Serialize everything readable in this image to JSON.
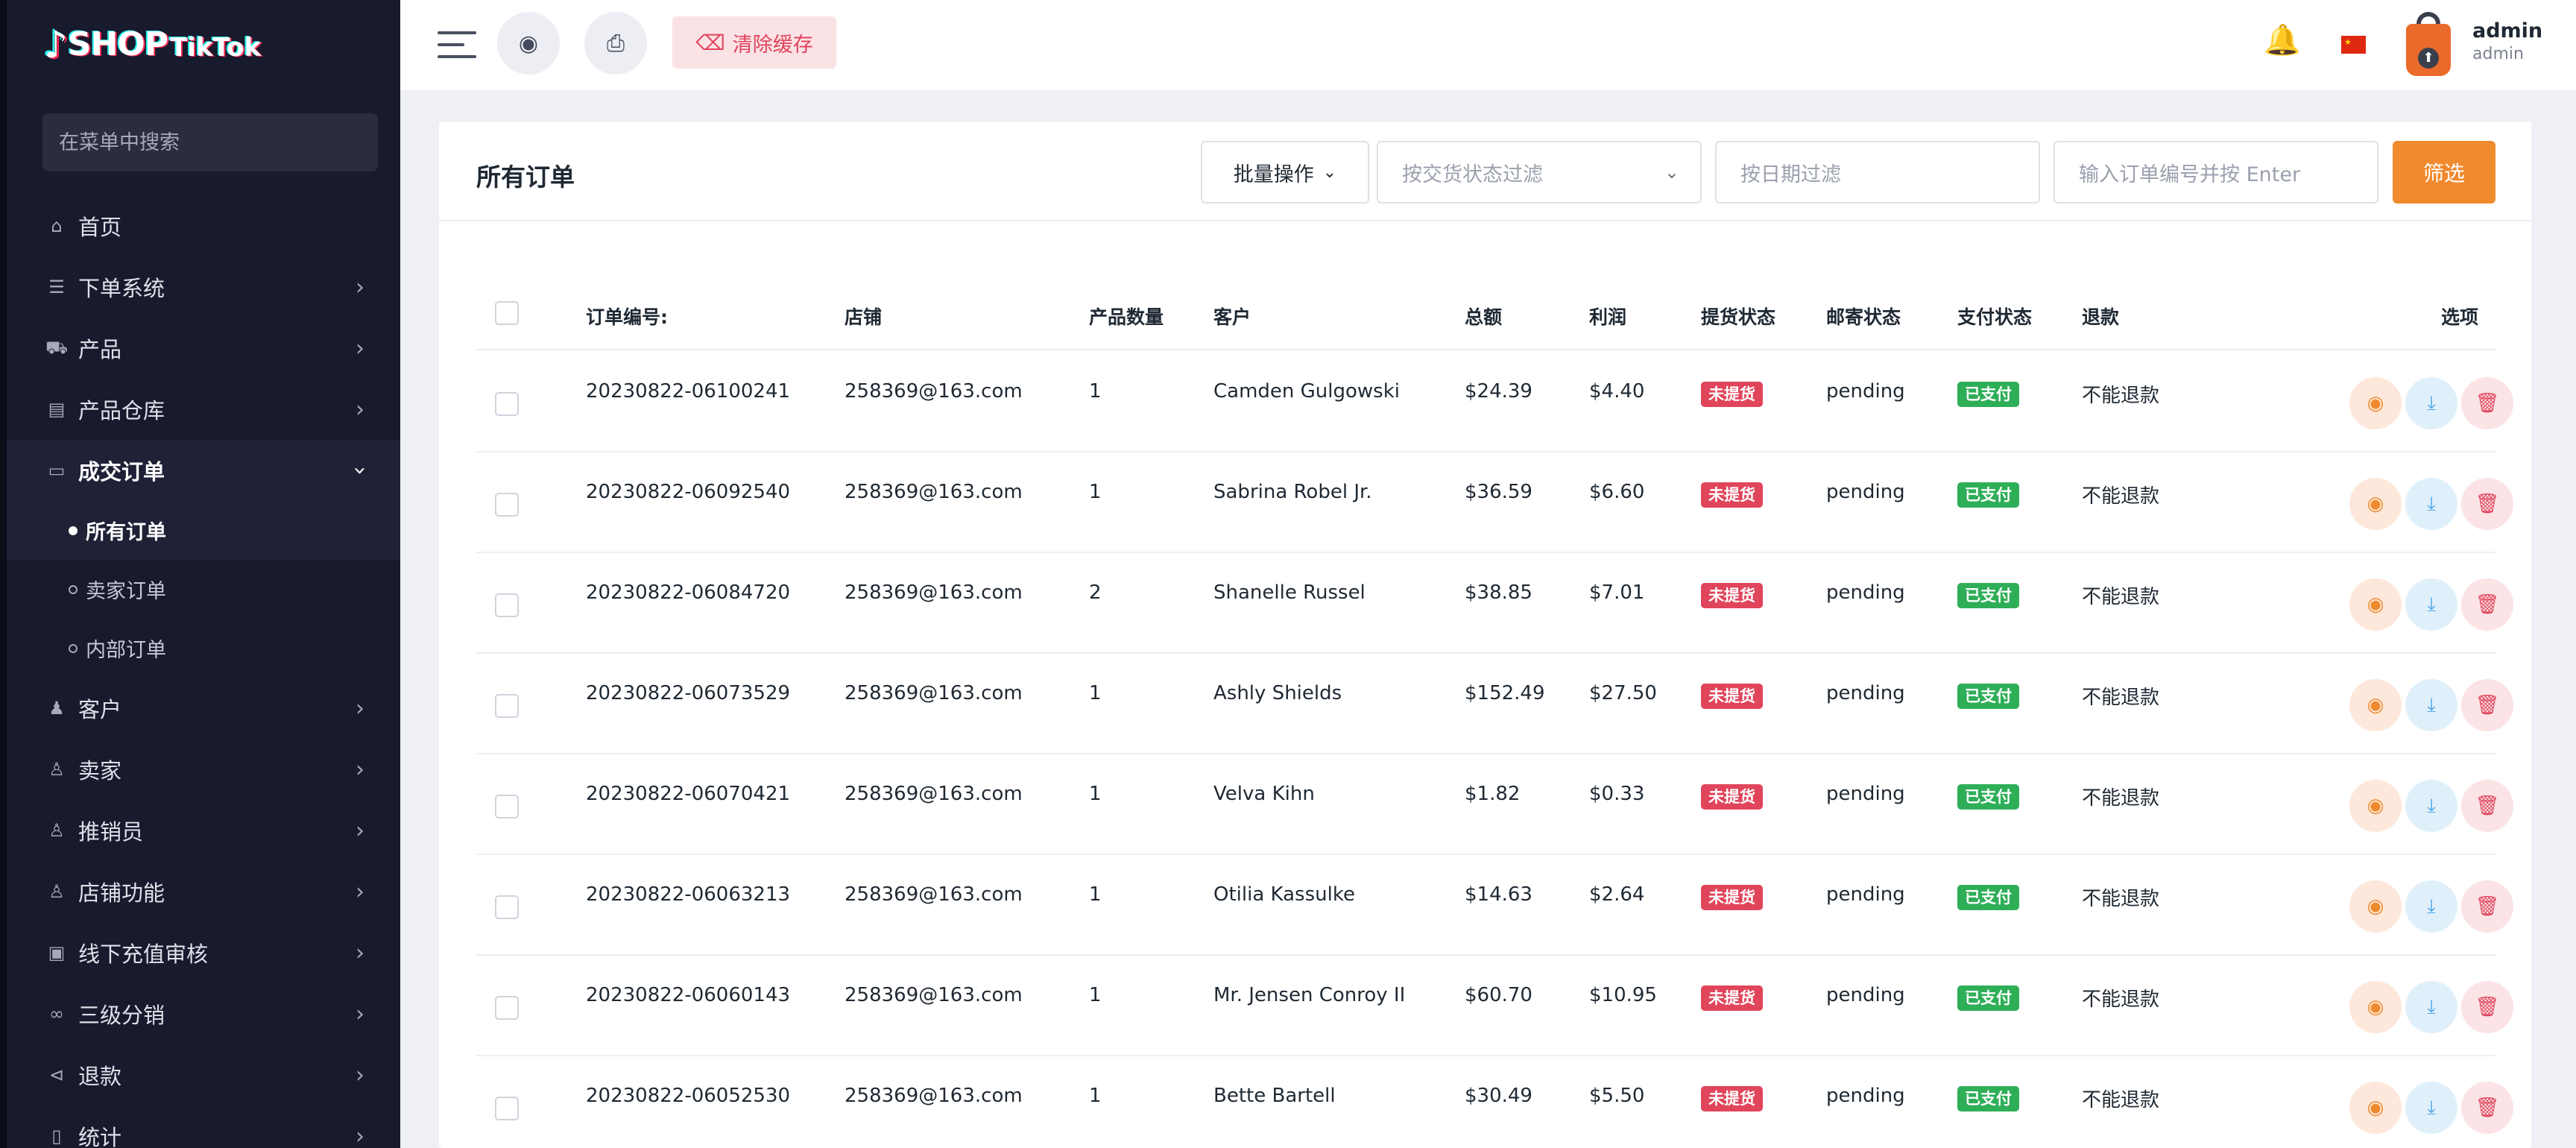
{
  "brand": {
    "note": "♪",
    "shop": "SHOP",
    "tiktok": "TikTok"
  },
  "sidebar": {
    "search_placeholder": "在菜单中搜索",
    "items": [
      {
        "label": "首页",
        "icon": "home-icon",
        "glyph": "⌂",
        "chevron": ""
      },
      {
        "label": "下单系统",
        "icon": "list-icon",
        "glyph": "☰",
        "chevron": "›"
      },
      {
        "label": "产品",
        "icon": "cart-icon",
        "glyph": "⛟",
        "chevron": "›"
      },
      {
        "label": "产品仓库",
        "icon": "warehouse-icon",
        "glyph": "▤",
        "chevron": "›"
      },
      {
        "label": "成交订单",
        "icon": "order-icon",
        "glyph": "▭",
        "chevron": "›"
      }
    ],
    "sub_items": [
      {
        "label": "所有订单"
      },
      {
        "label": "卖家订单"
      },
      {
        "label": "内部订单"
      }
    ],
    "items2": [
      {
        "label": "客户",
        "icon": "customers-icon",
        "glyph": "♟",
        "chevron": "›"
      },
      {
        "label": "卖家",
        "icon": "seller-icon",
        "glyph": "♙",
        "chevron": "›"
      },
      {
        "label": "推销员",
        "icon": "salesperson-icon",
        "glyph": "♙",
        "chevron": "›"
      },
      {
        "label": "店铺功能",
        "icon": "store-icon",
        "glyph": "♙",
        "chevron": "›"
      },
      {
        "label": "线下充值审核",
        "icon": "money-icon",
        "glyph": "▣",
        "chevron": "›"
      },
      {
        "label": "三级分销",
        "icon": "link-icon",
        "glyph": "∞",
        "chevron": "›"
      },
      {
        "label": "退款",
        "icon": "refund-icon",
        "glyph": "⊲",
        "chevron": "›"
      },
      {
        "label": "统计",
        "icon": "stats-icon",
        "glyph": "▯",
        "chevron": "›"
      }
    ]
  },
  "topbar": {
    "clear_cache": "清除缓存",
    "globe_glyph": "◉",
    "print_glyph": "⎙",
    "bell_glyph": "🔔",
    "user_name": "admin",
    "user_role": "admin"
  },
  "page": {
    "title": "所有订单",
    "batch_label": "批量操作",
    "delivery_filter_placeholder": "按交货状态过滤",
    "date_filter_placeholder": "按日期过滤",
    "order_search_placeholder": "输入订单编号并按 Enter",
    "filter_button": "筛选"
  },
  "table": {
    "headers": {
      "order_no": "订单编号:",
      "store": "店铺",
      "qty": "产品数量",
      "customer": "客户",
      "total": "总额",
      "profit": "利润",
      "pickup": "提货状态",
      "shipping": "邮寄状态",
      "payment": "支付状态",
      "refund": "退款",
      "options": "选项"
    },
    "rows": [
      {
        "order_no": "20230822-06100241",
        "store": "258369@163.com",
        "qty": "1",
        "customer": "Camden Gulgowski",
        "total": "$24.39",
        "profit": "$4.40",
        "pickup": "未提货",
        "shipping": "pending",
        "payment": "已支付",
        "refund": "不能退款"
      },
      {
        "order_no": "20230822-06092540",
        "store": "258369@163.com",
        "qty": "1",
        "customer": "Sabrina Robel Jr.",
        "total": "$36.59",
        "profit": "$6.60",
        "pickup": "未提货",
        "shipping": "pending",
        "payment": "已支付",
        "refund": "不能退款"
      },
      {
        "order_no": "20230822-06084720",
        "store": "258369@163.com",
        "qty": "2",
        "customer": "Shanelle Russel",
        "total": "$38.85",
        "profit": "$7.01",
        "pickup": "未提货",
        "shipping": "pending",
        "payment": "已支付",
        "refund": "不能退款"
      },
      {
        "order_no": "20230822-06073529",
        "store": "258369@163.com",
        "qty": "1",
        "customer": "Ashly Shields",
        "total": "$152.49",
        "profit": "$27.50",
        "pickup": "未提货",
        "shipping": "pending",
        "payment": "已支付",
        "refund": "不能退款"
      },
      {
        "order_no": "20230822-06070421",
        "store": "258369@163.com",
        "qty": "1",
        "customer": "Velva Kihn",
        "total": "$1.82",
        "profit": "$0.33",
        "pickup": "未提货",
        "shipping": "pending",
        "payment": "已支付",
        "refund": "不能退款"
      },
      {
        "order_no": "20230822-06063213",
        "store": "258369@163.com",
        "qty": "1",
        "customer": "Otilia Kassulke",
        "total": "$14.63",
        "profit": "$2.64",
        "pickup": "未提货",
        "shipping": "pending",
        "payment": "已支付",
        "refund": "不能退款"
      },
      {
        "order_no": "20230822-06060143",
        "store": "258369@163.com",
        "qty": "1",
        "customer": "Mr. Jensen Conroy II",
        "total": "$60.70",
        "profit": "$10.95",
        "pickup": "未提货",
        "shipping": "pending",
        "payment": "已支付",
        "refund": "不能退款"
      },
      {
        "order_no": "20230822-06052530",
        "store": "258369@163.com",
        "qty": "1",
        "customer": "Bette Bartell",
        "total": "$30.49",
        "profit": "$5.50",
        "pickup": "未提货",
        "shipping": "pending",
        "payment": "已支付",
        "refund": "不能退款"
      }
    ],
    "action_icons": {
      "view": "◉",
      "download": "⤓",
      "delete": "🗑"
    }
  },
  "colors": {
    "sidebar_bg": "#181a2d",
    "accent_orange": "#f08a2e",
    "badge_red": "#e0455b",
    "badge_green": "#2fae58",
    "clear_cache_bg": "#fbe2e5"
  }
}
